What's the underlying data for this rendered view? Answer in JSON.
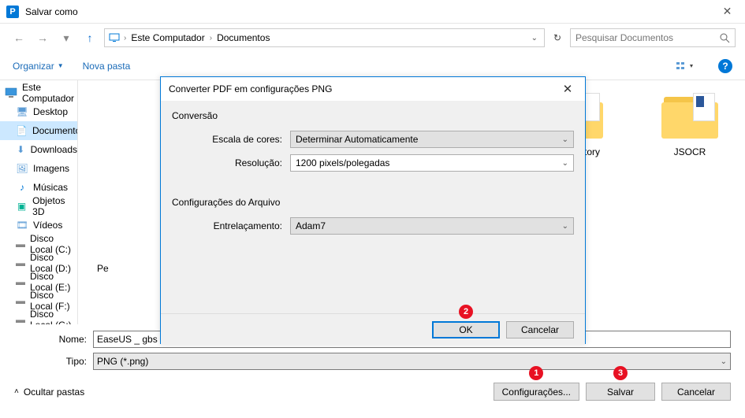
{
  "window": {
    "title": "Salvar como",
    "close": "✕"
  },
  "nav": {
    "back": "←",
    "forward": "→",
    "up": "↑",
    "breadcrumb": [
      "Este Computador",
      "Documentos"
    ],
    "refresh": "↻",
    "search_placeholder": "Pesquisar Documentos"
  },
  "toolbar": {
    "organize": "Organizar",
    "new_folder": "Nova pasta"
  },
  "sidebar": {
    "root": "Este Computador",
    "items": [
      {
        "label": "Desktop",
        "icon": "🖥"
      },
      {
        "label": "Documentos",
        "icon": "📄",
        "active": true
      },
      {
        "label": "Downloads",
        "icon": "⬇"
      },
      {
        "label": "Imagens",
        "icon": "🖼"
      },
      {
        "label": "Músicas",
        "icon": "♪"
      },
      {
        "label": "Objetos 3D",
        "icon": "▣"
      },
      {
        "label": "Vídeos",
        "icon": "🎞"
      },
      {
        "label": "Disco Local (C:)",
        "icon": "▬"
      },
      {
        "label": "Disco Local (D:)",
        "icon": "▬"
      },
      {
        "label": "Disco Local (E:)",
        "icon": "▬"
      },
      {
        "label": "Disco Local (F:)",
        "icon": "▬"
      },
      {
        "label": "Disco Local (G:)",
        "icon": "▬"
      }
    ]
  },
  "content": {
    "folders": [
      {
        "label": "rmatFactory"
      },
      {
        "label": "JSOCR"
      }
    ],
    "partial_label": "Pe"
  },
  "form": {
    "name_label": "Nome:",
    "name_value": "EaseUS _ gbs go.png",
    "type_label": "Tipo:",
    "type_value": "PNG (*.png)"
  },
  "footer": {
    "hide_folders": "Ocultar pastas",
    "config": "Configurações...",
    "save": "Salvar",
    "cancel": "Cancelar"
  },
  "modal": {
    "title": "Converter PDF em configurações PNG",
    "group1": "Conversão",
    "color_label": "Escala de cores:",
    "color_value": "Determinar Automaticamente",
    "res_label": "Resolução:",
    "res_value": "1200 pixels/polegadas",
    "group2": "Configurações do Arquivo",
    "inter_label": "Entrelaçamento:",
    "inter_value": "Adam7",
    "ok": "OK",
    "cancel": "Cancelar"
  },
  "badges": {
    "config": "1",
    "ok": "2",
    "save": "3"
  }
}
